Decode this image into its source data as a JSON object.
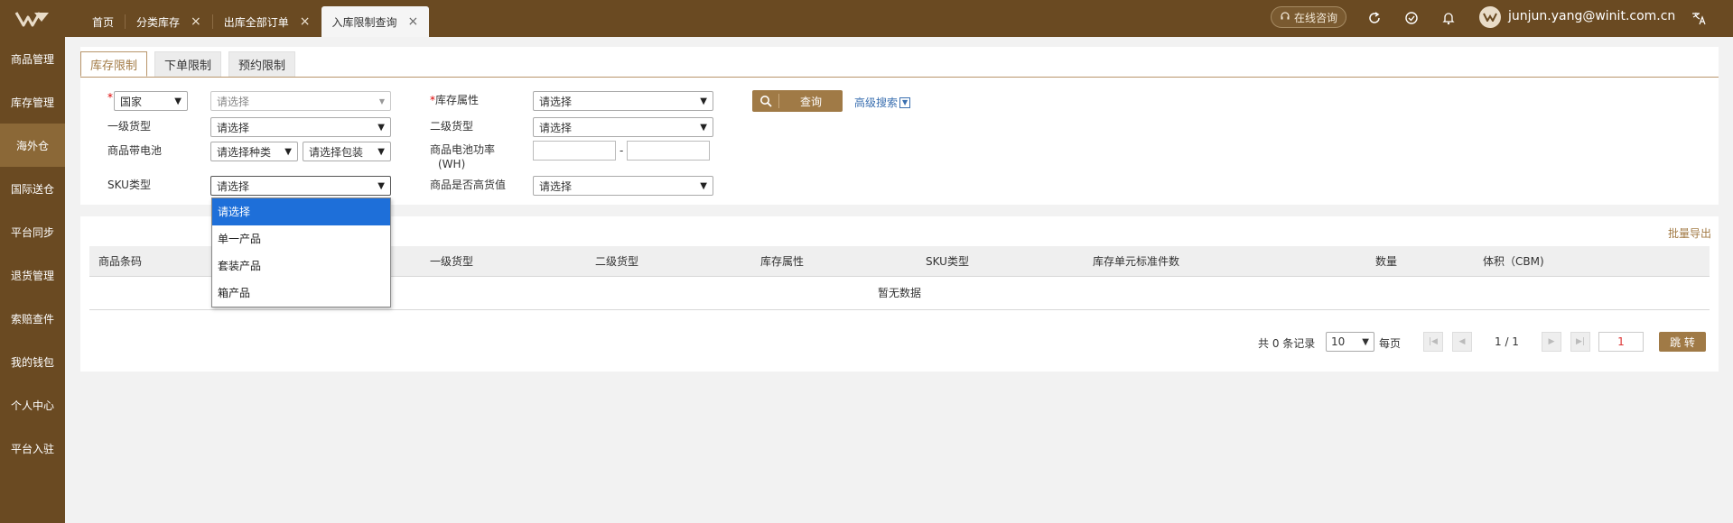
{
  "topbar": {
    "tabs": [
      {
        "label": "首页",
        "closable": false,
        "active": false
      },
      {
        "label": "分类库存",
        "closable": true,
        "active": false
      },
      {
        "label": "出库全部订单",
        "closable": true,
        "active": false
      },
      {
        "label": "入库限制查询",
        "closable": true,
        "active": true
      }
    ],
    "close_glyph": "×",
    "consult_label": "在线咨询",
    "username": "junjun.yang@winit.com.cn"
  },
  "sidebar": {
    "items": [
      {
        "label": "商品管理",
        "active": false
      },
      {
        "label": "库存管理",
        "active": false
      },
      {
        "label": "海外仓",
        "active": true
      },
      {
        "label": "国际送仓",
        "active": false
      },
      {
        "label": "平台同步",
        "active": false
      },
      {
        "label": "退货管理",
        "active": false
      },
      {
        "label": "索赔查件",
        "active": false
      },
      {
        "label": "我的钱包",
        "active": false
      },
      {
        "label": "个人中心",
        "active": false
      },
      {
        "label": "平台入驻",
        "active": false
      }
    ]
  },
  "subtabs": [
    "库存限制",
    "下单限制",
    "预约限制"
  ],
  "filters": {
    "required_mark": "*",
    "country_select": "国家",
    "country_value_placeholder": "请选择",
    "stock_attr_label": "库存属性",
    "stock_attr_value": "请选择",
    "cat1_label": "一级货型",
    "cat1_value": "请选择",
    "cat2_label": "二级货型",
    "cat2_value": "请选择",
    "battery_label": "商品带电池",
    "battery_type_value": "请选择种类",
    "battery_pack_value": "请选择包装",
    "battery_power_label": "商品电池功率",
    "battery_power_unit": "(WH)",
    "range_sep": "-",
    "sku_label": "SKU类型",
    "sku_value": "请选择",
    "high_value_label": "商品是否高货值",
    "high_value_value": "请选择",
    "query_label": "查询",
    "advanced_label": "高级搜索"
  },
  "sku_dropdown": {
    "options": [
      "请选择",
      "单一产品",
      "套装产品",
      "箱产品"
    ],
    "highlighted_index": 0
  },
  "results": {
    "export_label": "批量导出",
    "columns": [
      "商品条码",
      "一级货型",
      "二级货型",
      "库存属性",
      "SKU类型",
      "库存单元标准件数",
      "数量",
      "体积（CBM)"
    ],
    "empty_text": "暂无数据"
  },
  "pagination": {
    "total_text": "共 0 条记录",
    "page_size": "10",
    "per_page_label": "每页",
    "page_info": "1 / 1",
    "page_input": "1",
    "go_label": "跳 转"
  },
  "colors": {
    "brand_brown": "#6a4a22",
    "accent": "#a07a46",
    "highlight_blue": "#1e6fd9"
  }
}
